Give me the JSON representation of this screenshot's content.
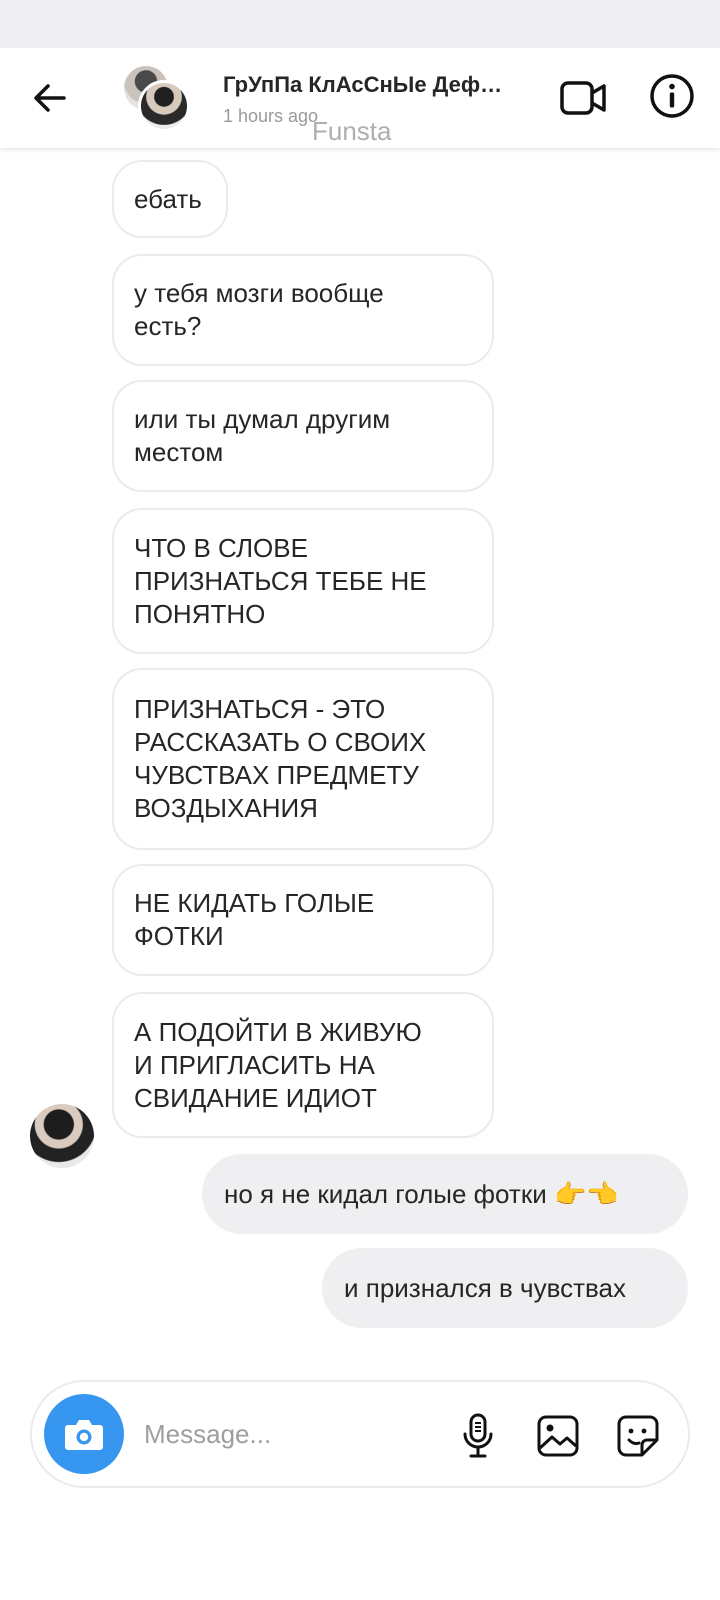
{
  "header": {
    "title": "ГрУпПа КлАсСнЫе Деф…",
    "subtitle": "1 hours ago",
    "watermark": "Funsta",
    "icons": {
      "back": "arrow-left-icon",
      "video": "video-camera-icon",
      "info": "info-icon"
    }
  },
  "messages": [
    {
      "direction": "in",
      "text": "ебать"
    },
    {
      "direction": "in",
      "text": "у тебя мозги вообще\nесть?"
    },
    {
      "direction": "in",
      "text": "или ты думал другим\nместом"
    },
    {
      "direction": "in",
      "text": "ЧТО В СЛОВЕ\nПРИЗНАТЬСЯ ТЕБЕ НЕ\nПОНЯТНО"
    },
    {
      "direction": "in",
      "text": "ПРИЗНАТЬСЯ - ЭТО\nРАССКАЗАТЬ О СВОИХ\nЧУВСТВАХ ПРЕДМЕТУ\nВОЗДЫХАНИЯ"
    },
    {
      "direction": "in",
      "text": "НЕ КИДАТЬ ГОЛЫЕ\nФОТКИ"
    },
    {
      "direction": "in",
      "text": "А ПОДОЙТИ В ЖИВУЮ\nИ ПРИГЛАСИТЬ НА\nСВИДАНИЕ ИДИОТ"
    },
    {
      "direction": "out",
      "text": "но я не кидал голые фотки 👉👈"
    },
    {
      "direction": "out",
      "text": "и признался в чувствах"
    }
  ],
  "composer": {
    "placeholder": "Message...",
    "icons": {
      "camera": "camera-icon",
      "mic": "microphone-icon",
      "gallery": "image-icon",
      "sticker": "sticker-icon"
    }
  },
  "colors": {
    "accent": "#3797f0",
    "incoming_border": "#ebebeb",
    "outgoing_bg": "#efeff1",
    "status_bar": "#efeff2"
  }
}
